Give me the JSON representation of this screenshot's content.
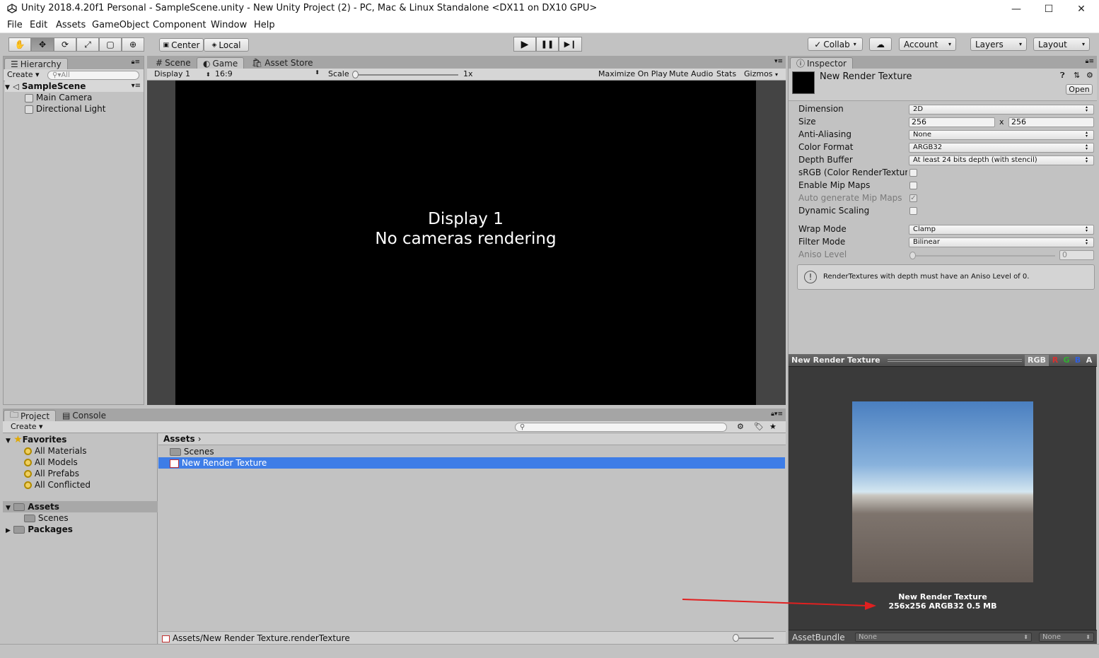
{
  "window": {
    "title": "Unity 2018.4.20f1 Personal - SampleScene.unity - New Unity Project (2) - PC, Mac & Linux Standalone <DX11 on DX10 GPU>",
    "minimize": "—",
    "maximize": "☐",
    "close": "✕"
  },
  "menu": [
    "File",
    "Edit",
    "Assets",
    "GameObject",
    "Component",
    "Window",
    "Help"
  ],
  "toolbar": {
    "tools": [
      "hand-icon",
      "move-icon",
      "rotate-icon",
      "scale-icon",
      "rect-tool-icon",
      "transform-tool-icon"
    ],
    "pivot": "Center",
    "space": "Local",
    "play": "▶",
    "pause": "❚❚",
    "step": "▶❙",
    "collab": "Collab",
    "account": "Account",
    "layers": "Layers",
    "layout": "Layout"
  },
  "hierarchy": {
    "tab": "Hierarchy",
    "create": "Create",
    "search_placeholder": "All",
    "scene": "SampleScene",
    "items": [
      "Main Camera",
      "Directional Light"
    ]
  },
  "game": {
    "tabs": [
      "Scene",
      "Game",
      "Asset Store"
    ],
    "display": "Display 1",
    "aspect": "16:9",
    "scale_label": "Scale",
    "scale_value": "1x",
    "options": [
      "Maximize On Play",
      "Mute Audio",
      "Stats",
      "Gizmos"
    ],
    "message_line1": "Display 1",
    "message_line2": "No cameras rendering"
  },
  "project": {
    "tabs": [
      "Project",
      "Console"
    ],
    "create": "Create",
    "favorites": "Favorites",
    "favorite_items": [
      "All Materials",
      "All Models",
      "All Prefabs",
      "All Conflicted"
    ],
    "assets": "Assets",
    "asset_children": [
      "Scenes"
    ],
    "packages": "Packages",
    "breadcrumb": "Assets",
    "files": [
      "Scenes",
      "New Render Texture"
    ],
    "status_path": "Assets/New Render Texture.renderTexture"
  },
  "inspector": {
    "tab": "Inspector",
    "asset_name": "New Render Texture",
    "open": "Open",
    "fields": {
      "dimension": {
        "label": "Dimension",
        "value": "2D"
      },
      "size": {
        "label": "Size",
        "w": "256",
        "sep": "x",
        "h": "256"
      },
      "anti_aliasing": {
        "label": "Anti-Aliasing",
        "value": "None"
      },
      "color_format": {
        "label": "Color Format",
        "value": "ARGB32"
      },
      "depth_buffer": {
        "label": "Depth Buffer",
        "value": "At least 24 bits depth (with stencil)"
      },
      "srgb": {
        "label": "sRGB (Color RenderTextur",
        "checked": false
      },
      "enable_mip": {
        "label": "Enable Mip Maps",
        "checked": false
      },
      "auto_mip": {
        "label": "Auto generate Mip Maps",
        "checked": true
      },
      "dynamic_scaling": {
        "label": "Dynamic Scaling",
        "checked": false
      },
      "wrap_mode": {
        "label": "Wrap Mode",
        "value": "Clamp"
      },
      "filter_mode": {
        "label": "Filter Mode",
        "value": "Bilinear"
      },
      "aniso": {
        "label": "Aniso Level",
        "value": "0"
      }
    },
    "warning": "RenderTextures with depth must have an Aniso Level of 0.",
    "preview": {
      "title": "New Render Texture",
      "channels": [
        "RGB",
        "R",
        "G",
        "B",
        "A"
      ],
      "caption_name": "New Render Texture",
      "caption_info": "256x256  ARGB32  0.5 MB"
    },
    "assetbundle_label": "AssetBundle",
    "assetbundle_value": "None",
    "assetbundle_variant": "None"
  },
  "colors": {
    "selection": "#3e7de7",
    "arrow": "#e02020",
    "game_bg": "#000000"
  }
}
